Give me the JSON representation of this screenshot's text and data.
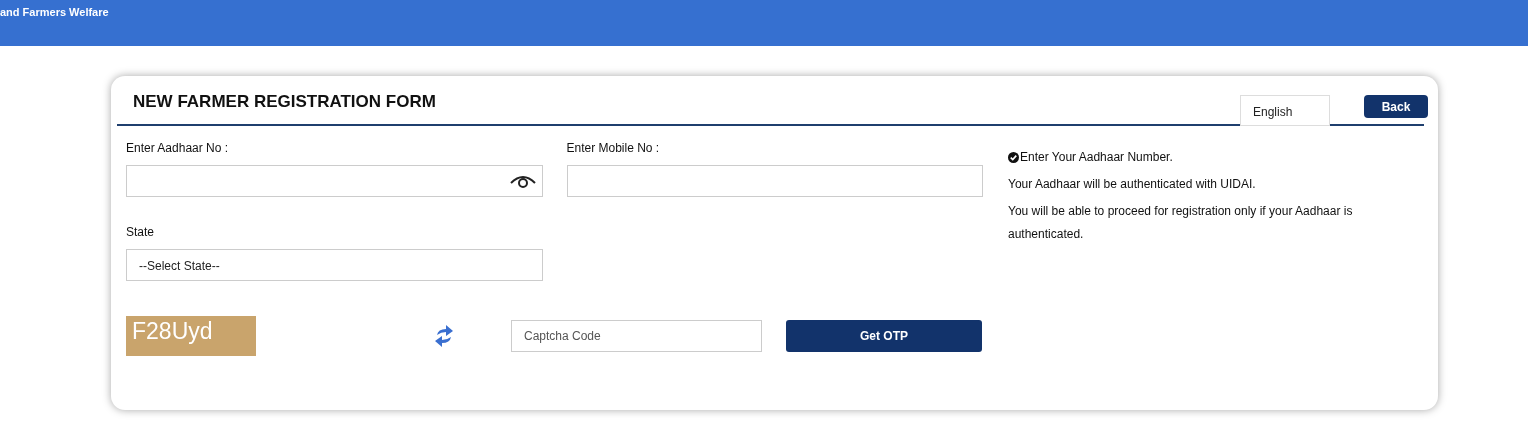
{
  "header": {
    "subtitle": "and Farmers Welfare"
  },
  "form": {
    "title": "NEW FARMER REGISTRATION FORM",
    "language": "English",
    "back_button": "Back",
    "aadhaar": {
      "label": "Enter Aadhaar No :"
    },
    "mobile": {
      "label": "Enter Mobile No :"
    },
    "state": {
      "label": "State",
      "placeholder": "--Select State--"
    },
    "captcha": {
      "image_text": "F28Uyd",
      "placeholder": "Captcha Code"
    },
    "submit_button": "Get OTP",
    "info": [
      {
        "kind": "check",
        "text": "Enter Your Aadhaar Number."
      },
      {
        "kind": "plain",
        "text": "Your Aadhaar will be authenticated with UIDAI."
      },
      {
        "kind": "plain",
        "text": "You will be able to proceed for registration only if your Aadhaar is authenticated."
      }
    ]
  }
}
